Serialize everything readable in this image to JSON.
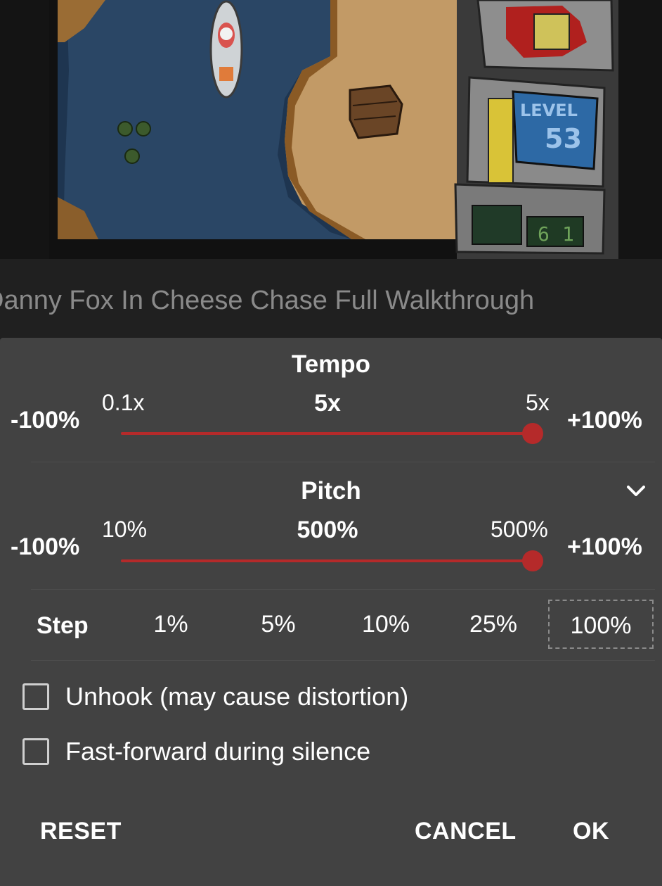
{
  "video": {
    "title": "Danny Fox In Cheese Chase Full Walkthrough",
    "game_hud": {
      "level_label": "LEVEL",
      "level_number": "53",
      "digits": [
        "6",
        "1"
      ]
    }
  },
  "dialog": {
    "tempo": {
      "title": "Tempo",
      "min_percent": "-100%",
      "max_percent": "+100%",
      "min_tick": "0.1x",
      "max_tick": "5x",
      "current": "5x",
      "position_fraction": 1.0
    },
    "pitch": {
      "title": "Pitch",
      "min_percent": "-100%",
      "max_percent": "+100%",
      "min_tick": "10%",
      "max_tick": "500%",
      "current": "500%",
      "position_fraction": 1.0,
      "expand_icon": "chevron-down-icon"
    },
    "step": {
      "label": "Step",
      "options": [
        "1%",
        "5%",
        "10%",
        "25%",
        "100%"
      ],
      "selected": "100%"
    },
    "checkboxes": {
      "unhook": {
        "label": "Unhook (may cause distortion)",
        "checked": false
      },
      "fast_forward": {
        "label": "Fast-forward during silence",
        "checked": false
      }
    },
    "buttons": {
      "reset": "RESET",
      "cancel": "CANCEL",
      "ok": "OK"
    }
  },
  "colors": {
    "accent": "#b52a2a",
    "dialog_bg": "#424242",
    "text": "#ffffff"
  }
}
